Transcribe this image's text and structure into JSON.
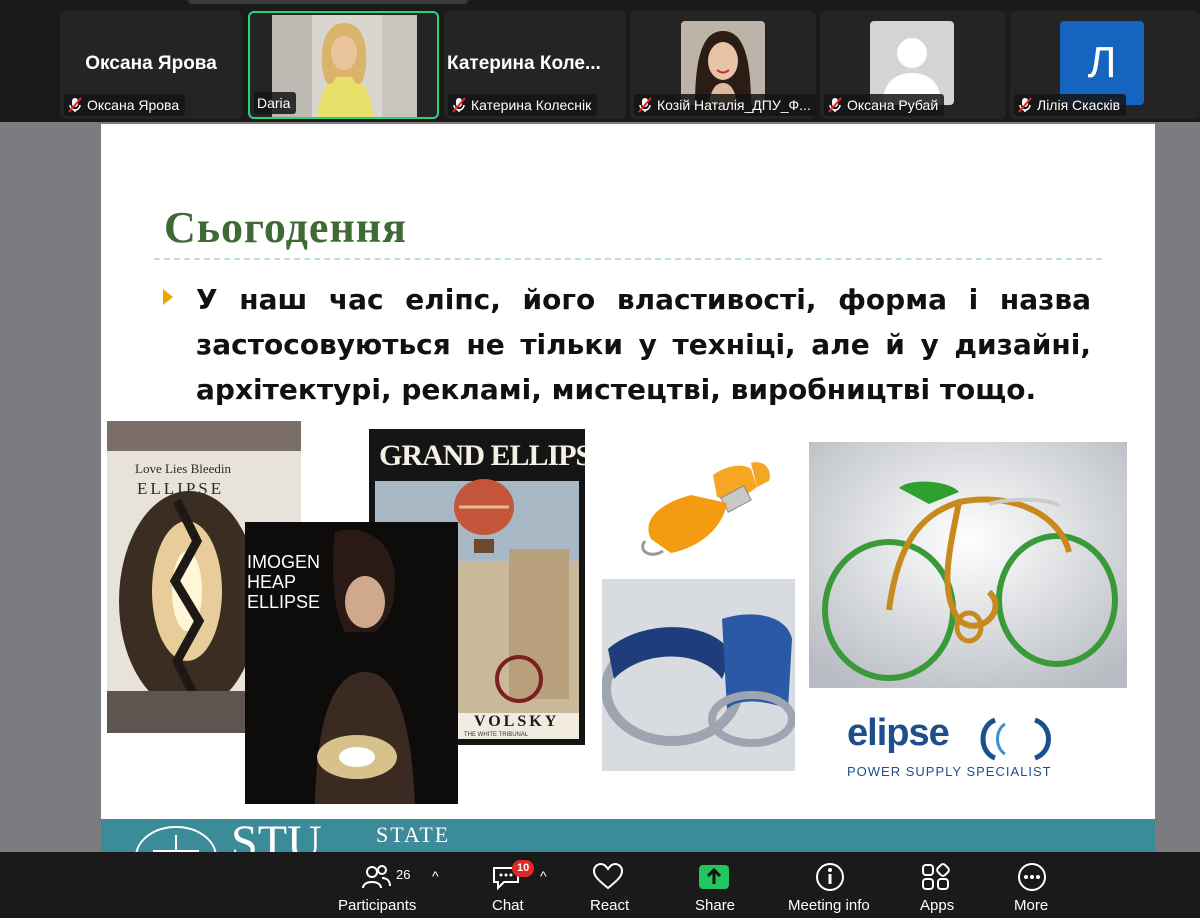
{
  "participants": [
    {
      "big_name": "Оксана Ярова",
      "label": "Оксана Ярова",
      "muted": true
    },
    {
      "big_name": "",
      "label": "Daria",
      "muted": false,
      "active": true
    },
    {
      "big_name": "Катерина  Коле...",
      "label": "Катерина Колеснік",
      "muted": true
    },
    {
      "big_name": "",
      "label": "Козій Наталія_ДПУ_Ф...",
      "muted": true
    },
    {
      "big_name": "",
      "label": "Оксана Рубай",
      "muted": true
    },
    {
      "big_name": "",
      "label": "Лілія Скасків",
      "muted": true,
      "avatar_letter": "Л"
    }
  ],
  "slide": {
    "title": "Сьогодення",
    "bullet": "У наш час еліпс, його властивості, форма і назва застосовуються не тільки у техніці, але й у дизайні, архітектурі, рекламі, мистецтві, виробництві тощо.",
    "covers": {
      "album1_line1": "Love Lies Bleedin",
      "album1_line2": "ELLIPSE",
      "album2_line1": "IMOGEN",
      "album2_line2": "HEAP",
      "album2_line3": "ELLIPSE",
      "book_title": "GRAND ELLIPSE",
      "book_author": "VOLSKY",
      "book_sub": "THE WHITE TRIBUNAL"
    },
    "logo": {
      "name": "elipse",
      "tagline": "POWER SUPPLY SPECIALIST"
    },
    "footer": {
      "big": "STU",
      "word": "STATE"
    }
  },
  "toolbar": {
    "participants": {
      "label": "Participants",
      "count": "26"
    },
    "chat": {
      "label": "Chat",
      "badge": "10"
    },
    "react": {
      "label": "React"
    },
    "share": {
      "label": "Share"
    },
    "meeting_info": {
      "label": "Meeting info"
    },
    "apps": {
      "label": "Apps"
    },
    "more": {
      "label": "More"
    }
  },
  "colors": {
    "active_border": "#2ed17a",
    "share_green": "#22c55e",
    "badge_red": "#e02828",
    "title_green": "#3f6a36"
  }
}
